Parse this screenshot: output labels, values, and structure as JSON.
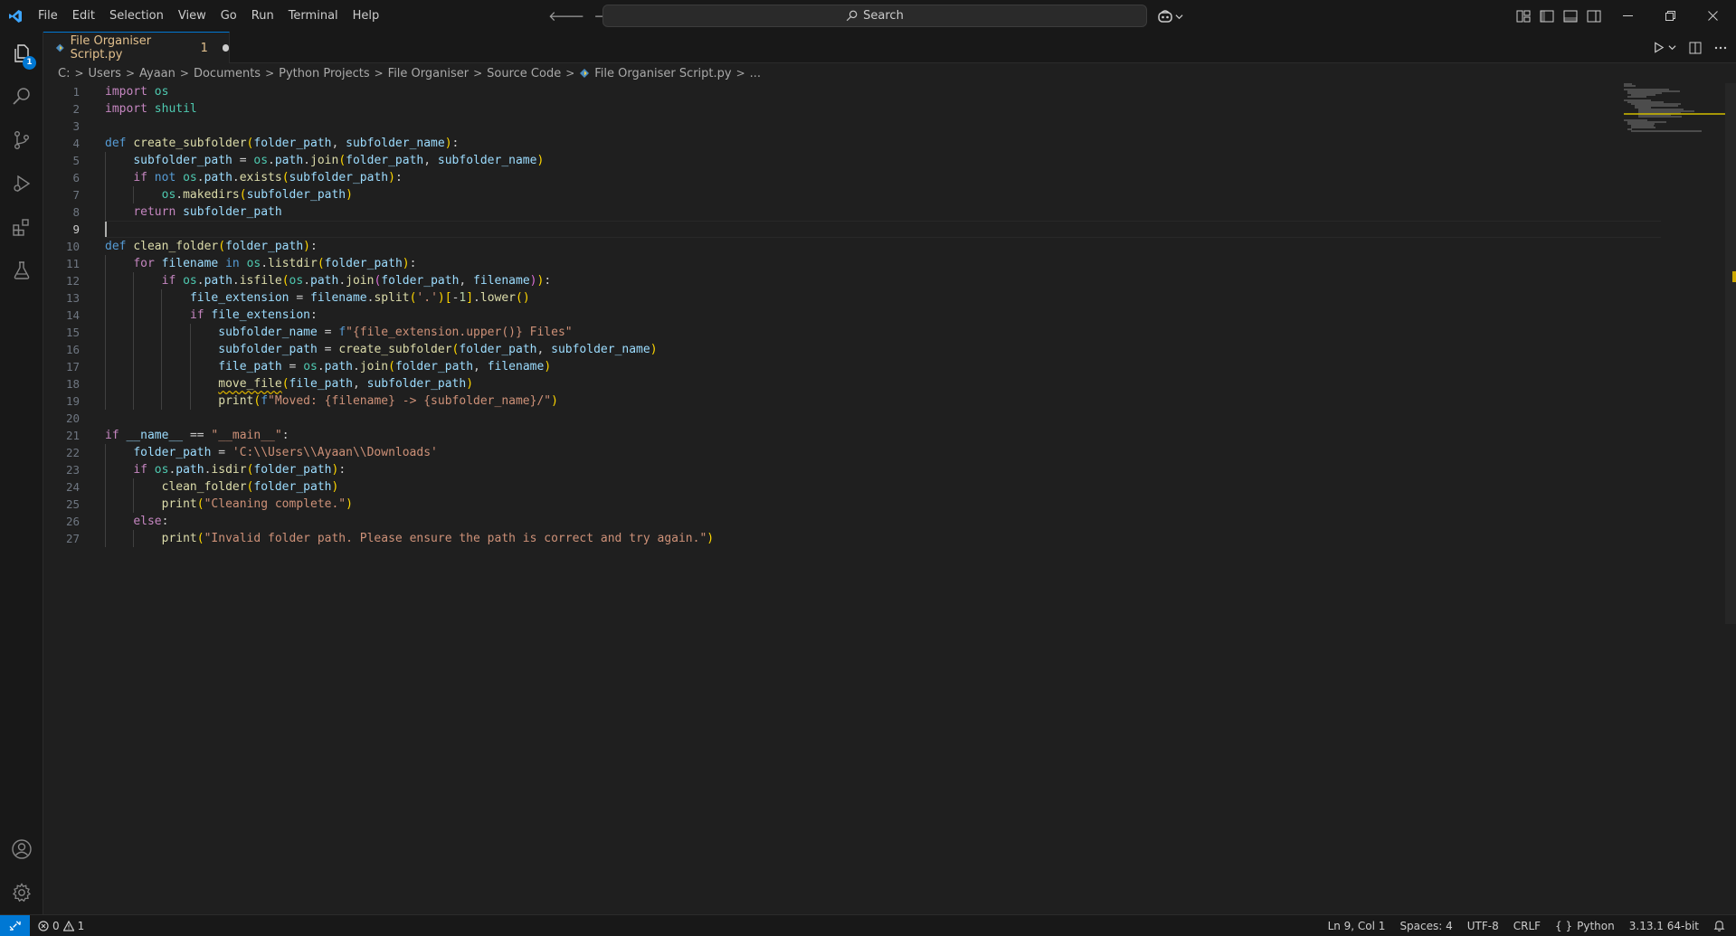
{
  "menu": [
    "File",
    "Edit",
    "Selection",
    "View",
    "Go",
    "Run",
    "Terminal",
    "Help"
  ],
  "search": {
    "label": "Search"
  },
  "tab": {
    "title": "File Organiser Script.py",
    "problems": "1"
  },
  "activity": {
    "explorer_badge": "1"
  },
  "breadcrumb": [
    "C:",
    "Users",
    "Ayaan",
    "Documents",
    "Python Projects",
    "File Organiser",
    "Source Code",
    "File Organiser Script.py",
    "..."
  ],
  "code_lines": [
    "import os",
    "import shutil",
    "",
    "def create_subfolder(folder_path, subfolder_name):",
    "    subfolder_path = os.path.join(folder_path, subfolder_name)",
    "    if not os.path.exists(subfolder_path):",
    "        os.makedirs(subfolder_path)",
    "    return subfolder_path",
    "",
    "def clean_folder(folder_path):",
    "    for filename in os.listdir(folder_path):",
    "        if os.path.isfile(os.path.join(folder_path, filename)):",
    "            file_extension = filename.split('.')[-1].lower()",
    "            if file_extension:",
    "                subfolder_name = f\"{file_extension.upper()} Files\"",
    "                subfolder_path = create_subfolder(folder_path, subfolder_name)",
    "                file_path = os.path.join(folder_path, filename)",
    "                move_file(file_path, subfolder_path)",
    "                print(f\"Moved: {filename} -> {subfolder_name}/\")",
    "",
    "if __name__ == \"__main__\":",
    "    folder_path = 'C:\\\\Users\\\\Ayaan\\\\Downloads'",
    "    if os.path.isdir(folder_path):",
    "        clean_folder(folder_path)",
    "        print(\"Cleaning complete.\")",
    "    else:",
    "        print(\"Invalid folder path. Please ensure the path is correct and try again.\")"
  ],
  "line_numbers": [
    "1",
    "2",
    "3",
    "4",
    "5",
    "6",
    "7",
    "8",
    "9",
    "10",
    "11",
    "12",
    "13",
    "14",
    "15",
    "16",
    "17",
    "18",
    "19",
    "20",
    "21",
    "22",
    "23",
    "24",
    "25",
    "26",
    "27"
  ],
  "status": {
    "errors": "0",
    "warnings": "1",
    "position": "Ln 9, Col 1",
    "spaces": "Spaces: 4",
    "encoding": "UTF-8",
    "eol": "CRLF",
    "language": "Python",
    "interpreter": "3.13.1 64-bit"
  },
  "colors": {
    "accent": "#0078d4",
    "tab_modified": "#e2c08d",
    "warning": "#cca700"
  }
}
